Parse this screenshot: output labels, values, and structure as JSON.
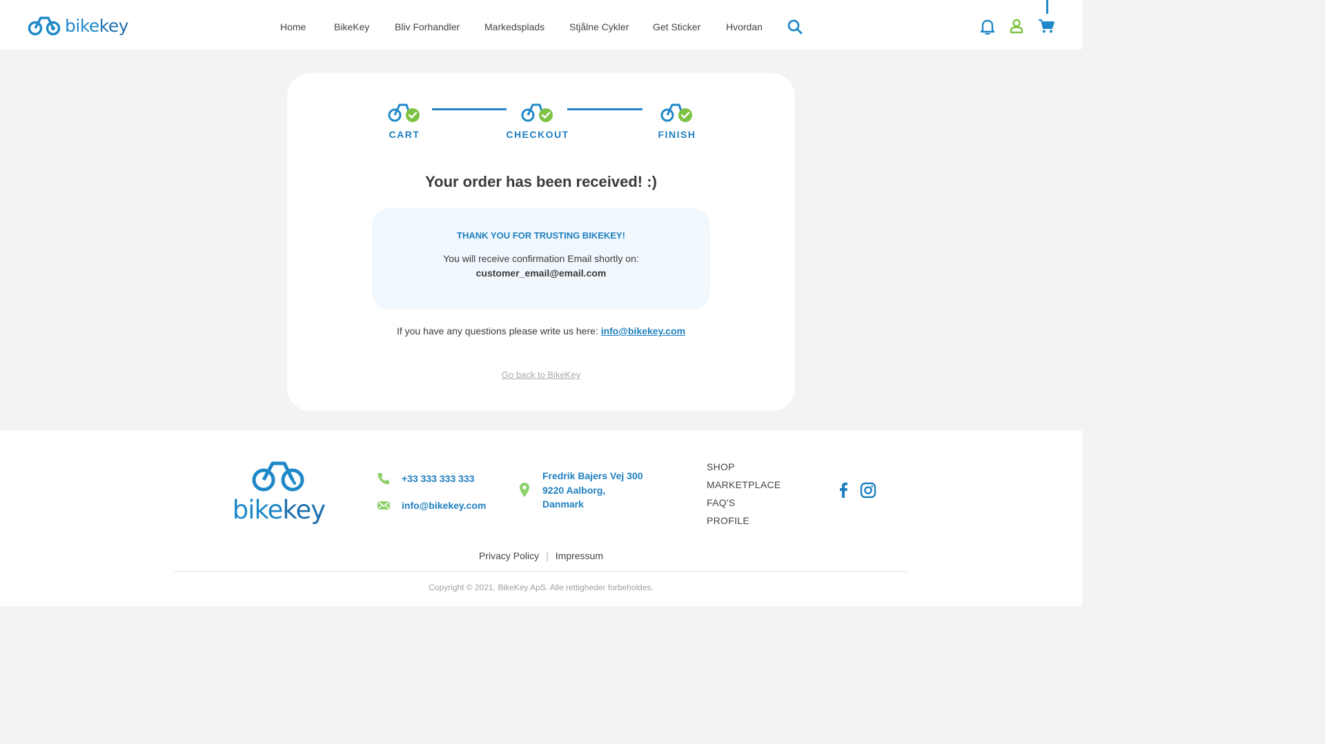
{
  "header": {
    "logo_text": "bikekey",
    "nav": [
      "Home",
      "BikeKey",
      "Bliv Forhandler",
      "Markedsplads",
      "Stjålne Cykler",
      "Get Sticker",
      "Hvordan"
    ],
    "icons": [
      "search-icon",
      "bell-icon",
      "user-icon",
      "cart-icon"
    ]
  },
  "steps": {
    "items": [
      {
        "label": "CART",
        "completed": true
      },
      {
        "label": "CHECKOUT",
        "completed": true
      },
      {
        "label": "FINISH",
        "completed": true
      }
    ]
  },
  "main": {
    "title": "Your order has been received! :)",
    "thanks": "THANK YOU FOR TRUSTING BIKEKEY!",
    "confirm_text": "You will receive confirmation Email shortly on:",
    "customer_email": "customer_email@email.com",
    "questions_text": "If you have any questions please write us here:",
    "questions_email": "info@bikekey.com",
    "back_link": "Go back to BikeKey"
  },
  "footer": {
    "logo_text": "bikekey",
    "phone": "+33 333 333 333",
    "email": "info@bikekey.com",
    "address": [
      "Fredrik Bajers Vej 300",
      "9220 Aalborg,",
      "Danmark"
    ],
    "links": [
      "SHOP",
      "MARKETPLACE",
      "FAQ'S",
      "PROFILE"
    ],
    "social": [
      "facebook-icon",
      "instagram-icon"
    ],
    "privacy": "Privacy Policy",
    "separator": "|",
    "impressum": "Impressum",
    "copyright": "Copyright © 2021, BikeKey ApS. Alle rettigheder forbeholdes."
  },
  "colors": {
    "brand_blue": "#1e88c8",
    "dark_blue": "#1e7fc0",
    "green": "#7cc242",
    "box_bg": "#f0f7fd",
    "page_bg": "#f3f3f3"
  }
}
